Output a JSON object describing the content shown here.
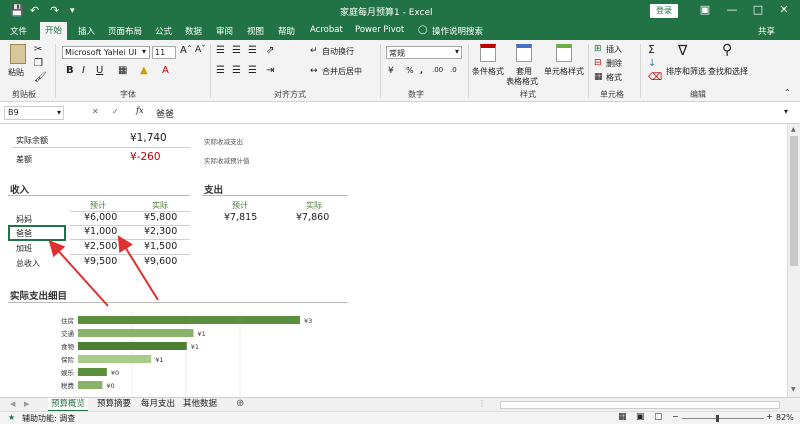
{
  "titlebar": {
    "title": "家庭每月预算1 - Excel",
    "login": "登录",
    "save_icon": "save-icon",
    "undo_icon": "undo-icon",
    "redo_icon": "redo-icon"
  },
  "tabs": [
    {
      "label": "文件"
    },
    {
      "label": "开始"
    },
    {
      "label": "插入"
    },
    {
      "label": "页面布局"
    },
    {
      "label": "公式"
    },
    {
      "label": "数据"
    },
    {
      "label": "审阅"
    },
    {
      "label": "视图"
    },
    {
      "label": "帮助"
    },
    {
      "label": "Acrobat"
    },
    {
      "label": "Power Pivot"
    },
    {
      "label": "操作说明搜索"
    },
    {
      "label": "共享"
    }
  ],
  "ribbon": {
    "paste": "粘贴",
    "clipboard": "剪贴板",
    "font_name": "Microsoft YaHei UI",
    "font_size": "11",
    "font_group": "字体",
    "align_group": "对齐方式",
    "wrap": "自动换行",
    "merge": "合并后居中",
    "number_format": "常规",
    "number_group": "数字",
    "percent": "%",
    "comma": ",",
    "conditional": "条件格式",
    "table_format_1": "套用",
    "table_format_2": "表格格式",
    "cell_style": "单元格样式",
    "style_group": "样式",
    "insert": "插入",
    "delete": "删除",
    "format": "格式",
    "cells_group": "单元格",
    "sort_filter": "排序和筛选",
    "find_select": "查找和选择",
    "edit_group": "编辑",
    "sigma": "Σ"
  },
  "formula_bar": {
    "name_box": "B9",
    "fx": "fx",
    "content": "爸爸"
  },
  "sheet": {
    "actual_balance_label": "实际余额",
    "actual_balance_value": "¥1,740",
    "actual_balance_note": "实际收减支出",
    "diff_label": "差额",
    "diff_value": "¥-260",
    "diff_note": "实际收减预计值",
    "income_title": "收入",
    "expense_title": "支出",
    "col_planned": "预计",
    "col_actual": "实际",
    "income_rows": [
      {
        "name": "妈妈",
        "planned": "¥6,000",
        "actual": "¥5,800"
      },
      {
        "name": "爸爸",
        "planned": "¥1,000",
        "actual": "¥2,300"
      },
      {
        "name": "加班",
        "planned": "¥2,500",
        "actual": "¥1,500"
      },
      {
        "name": "总收入",
        "planned": "¥9,500",
        "actual": "¥9,600"
      }
    ],
    "expense_planned": "¥7,815",
    "expense_actual": "¥7,860",
    "detail_title": "实际支出细目"
  },
  "chart_data": {
    "type": "bar",
    "orientation": "horizontal",
    "categories": [
      "住房",
      "交通",
      "食物",
      "保险",
      "娱乐",
      "税费"
    ],
    "values": [
      3,
      1,
      1,
      1,
      0,
      0
    ],
    "data_labels": [
      "¥3",
      "¥1",
      "¥1",
      "¥1",
      "¥0",
      "¥0"
    ],
    "bar_lengths": [
      1.0,
      0.52,
      0.49,
      0.33,
      0.13,
      0.11
    ],
    "colors": [
      "#5b8f3c",
      "#8ab26a",
      "#4d7f32",
      "#a9cc8b",
      "#5b8f3c",
      "#8ab26a"
    ]
  },
  "sheet_tabs": [
    "预算概览",
    "预算摘要",
    "每月支出",
    "其他数据"
  ],
  "status": {
    "accessibility": "辅助功能: 调查",
    "zoom": "82%"
  },
  "colors": {
    "excel_green": "#217346",
    "negative_red": "#c00000",
    "arrow_red": "#e03030"
  }
}
